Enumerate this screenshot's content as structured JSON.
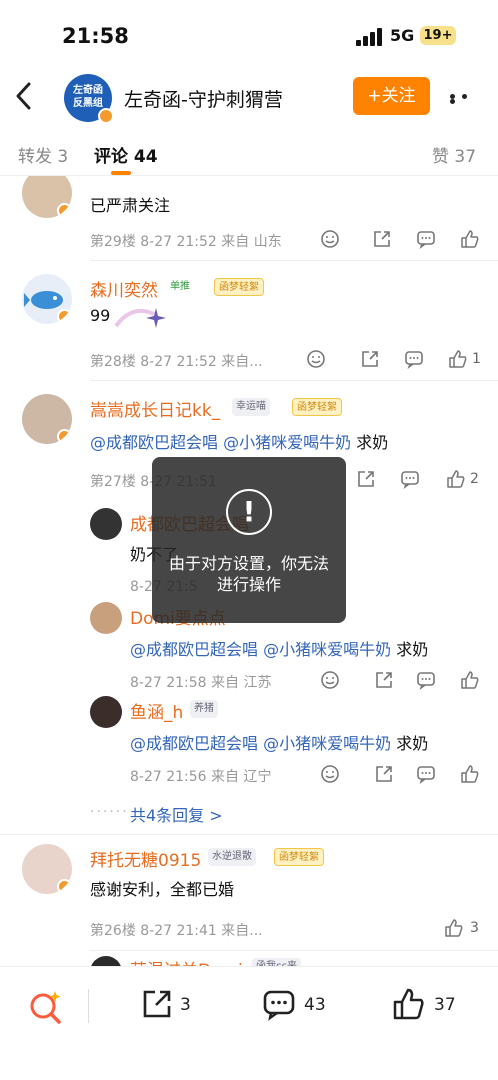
{
  "status_bar": {
    "time": "21:58",
    "network": "5G",
    "battery": "19+"
  },
  "header": {
    "avatar_text": "左奇函反黑组",
    "title": "左奇函-守护刺猬营",
    "follow_label": "+关注"
  },
  "tabs": {
    "repost": "转发 3",
    "comments": "评论 44",
    "likes": "赞 37"
  },
  "comments": [
    {
      "text": "已严肃关注",
      "meta": "第29楼  8-27 21:52  来自 山东",
      "likes": ""
    },
    {
      "name": "森川奕然",
      "badges": [
        "单推",
        "函梦轻絮"
      ],
      "text": "99",
      "meta": "第28楼  8-27 21:52  来自...",
      "likes": "1"
    },
    {
      "name": "嵩嵩成长日记kk_",
      "badges": [
        "幸运喵",
        "函梦轻絮"
      ],
      "mention1": "@成都欧巴超会唱",
      "mention2": "@小猪咪爱喝牛奶",
      "text": "求奶",
      "meta": "第27楼  8-27 21:51",
      "likes": "2",
      "replies": [
        {
          "name": "成都欧巴超会唱",
          "text": "奶不了",
          "meta": "8-27 21:5"
        },
        {
          "name": "Domi要点点",
          "mention1": "@成都欧巴超会唱",
          "mention2": "@小猪咪爱喝牛奶",
          "text": "求奶",
          "meta": "8-27 21:58  来自 江苏"
        },
        {
          "name": "鱼涵_h",
          "badge": "养猪",
          "mention1": "@成都欧巴超会唱",
          "mention2": "@小猪咪爱喝牛奶",
          "text": "求奶",
          "meta": "8-27 21:56  来自 辽宁"
        }
      ],
      "more_replies": "共4条回复 >"
    },
    {
      "name": "拜托无糖0915",
      "badges": [
        "水逆退散",
        "函梦轻絮"
      ],
      "text": "感谢安利，全都已婚",
      "meta": "第26楼  8-27 21:41  来自...",
      "likes": "3"
    },
    {
      "name": "萌混过关Domi",
      "badge": "函我cc来"
    }
  ],
  "toast": {
    "message": "由于对方设置，你无法进行操作"
  },
  "bottom_bar": {
    "reposts": "3",
    "comments": "43",
    "likes": "37"
  },
  "colors": {
    "accent": "#ff8200",
    "username": "#e86c1f",
    "mention": "#3466b8"
  }
}
